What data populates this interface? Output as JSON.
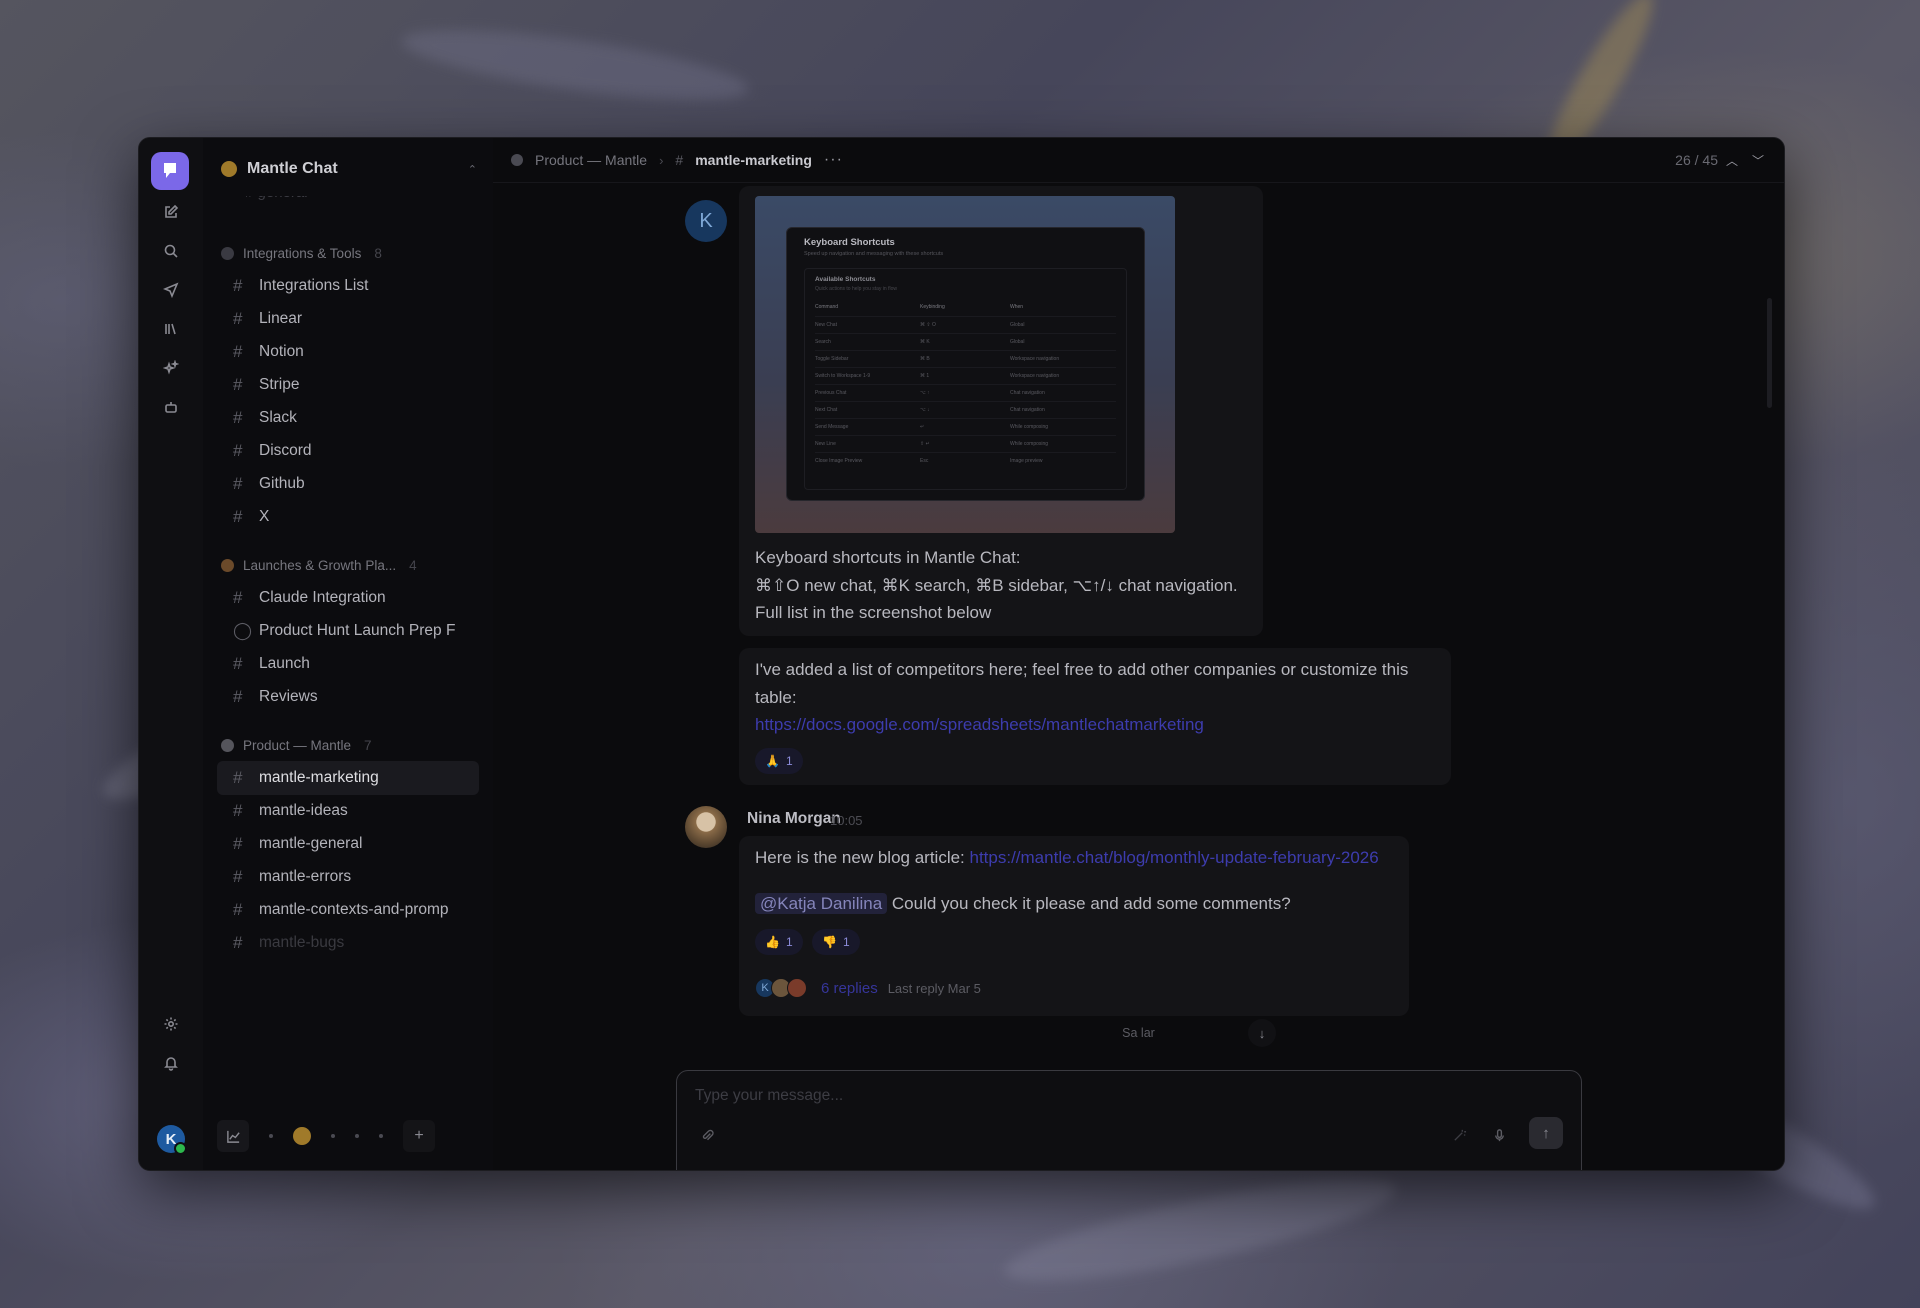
{
  "workspace": {
    "name": "Mantle Chat"
  },
  "sidebar": {
    "cut_item": "general",
    "groups": [
      {
        "label": "Integrations & Tools",
        "count": "8"
      },
      {
        "label": "Launches & Growth Pla...",
        "count": "4"
      },
      {
        "label": "Product — Mantle",
        "count": "7"
      }
    ],
    "channels": {
      "integrations": [
        "Integrations List",
        "Linear",
        "Notion",
        "Stripe",
        "Slack",
        "Discord",
        "Github",
        "X"
      ],
      "launches": [
        "Claude Integration",
        "Product Hunt Launch Prep F",
        "Launch",
        "Reviews"
      ],
      "product": [
        "mantle-marketing",
        "mantle-ideas",
        "mantle-general",
        "mantle-errors",
        "mantle-contexts-and-promp",
        "mantle-bugs"
      ]
    }
  },
  "header": {
    "breadcrumb_parent": "Product — Mantle",
    "channel": "mantle-marketing",
    "more": "···",
    "pager": "26 / 45"
  },
  "messages": {
    "first": {
      "avatar_letter": "K",
      "screenshot": {
        "title": "Keyboard Shortcuts",
        "subtitle": "Speed up navigation and messaging with these shortcuts",
        "section_title": "Available Shortcuts",
        "section_subtitle": "Quick actions to help you stay in flow",
        "columns": [
          "Command",
          "Keybinding",
          "When"
        ],
        "rows": [
          [
            "New Chat",
            "⌘ ⇧ O",
            "Global"
          ],
          [
            "Search",
            "⌘ K",
            "Global"
          ],
          [
            "Toggle Sidebar",
            "⌘ B",
            "Workspace navigation"
          ],
          [
            "Switch to Workspace 1-9",
            "⌘ 1",
            "Workspace navigation"
          ],
          [
            "Previous Chat",
            "⌥ ↑",
            "Chat navigation"
          ],
          [
            "Next Chat",
            "⌥ ↓",
            "Chat navigation"
          ],
          [
            "Send Message",
            "↵",
            "While composing"
          ],
          [
            "New Line",
            "⇧ ↵",
            "While composing"
          ],
          [
            "Close Image Preview",
            "Esc",
            "Image preview"
          ]
        ]
      },
      "line1": "Keyboard shortcuts in Mantle Chat:",
      "line2": "⌘⇧O new chat, ⌘K search, ⌘B sidebar, ⌥↑/↓ chat navigation.",
      "line3": "Full list in the screenshot below"
    },
    "second": {
      "text_line1": "I've added a list of competitors here; feel free to add other companies or customize this",
      "text_line2": "table:",
      "link": "https://docs.google.com/spreadsheets/mantlechatmarketing",
      "reaction": {
        "emoji": "🙏",
        "count": "1"
      }
    },
    "third": {
      "author": "Nina Morgan",
      "time": "10:05",
      "text_prefix": "Here is the new blog article: ",
      "link": "https://mantle.chat/blog/monthly-update-february-2026",
      "mention": "@Katja Danilina",
      "text_after_mention": " Could you check it please and add some comments?",
      "reactions": [
        {
          "emoji": "👍",
          "count": "1"
        },
        {
          "emoji": "👎",
          "count": "1"
        }
      ],
      "reply_avatar_letter": "K",
      "replies_count": "6 replies",
      "last_reply": "Last reply Mar 5"
    }
  },
  "date_divider": "Sa   lar",
  "composer": {
    "placeholder": "Type your message..."
  },
  "colors": {
    "accent": "#7b68e8",
    "link": "#3d3cae",
    "online": "#2db84d"
  }
}
